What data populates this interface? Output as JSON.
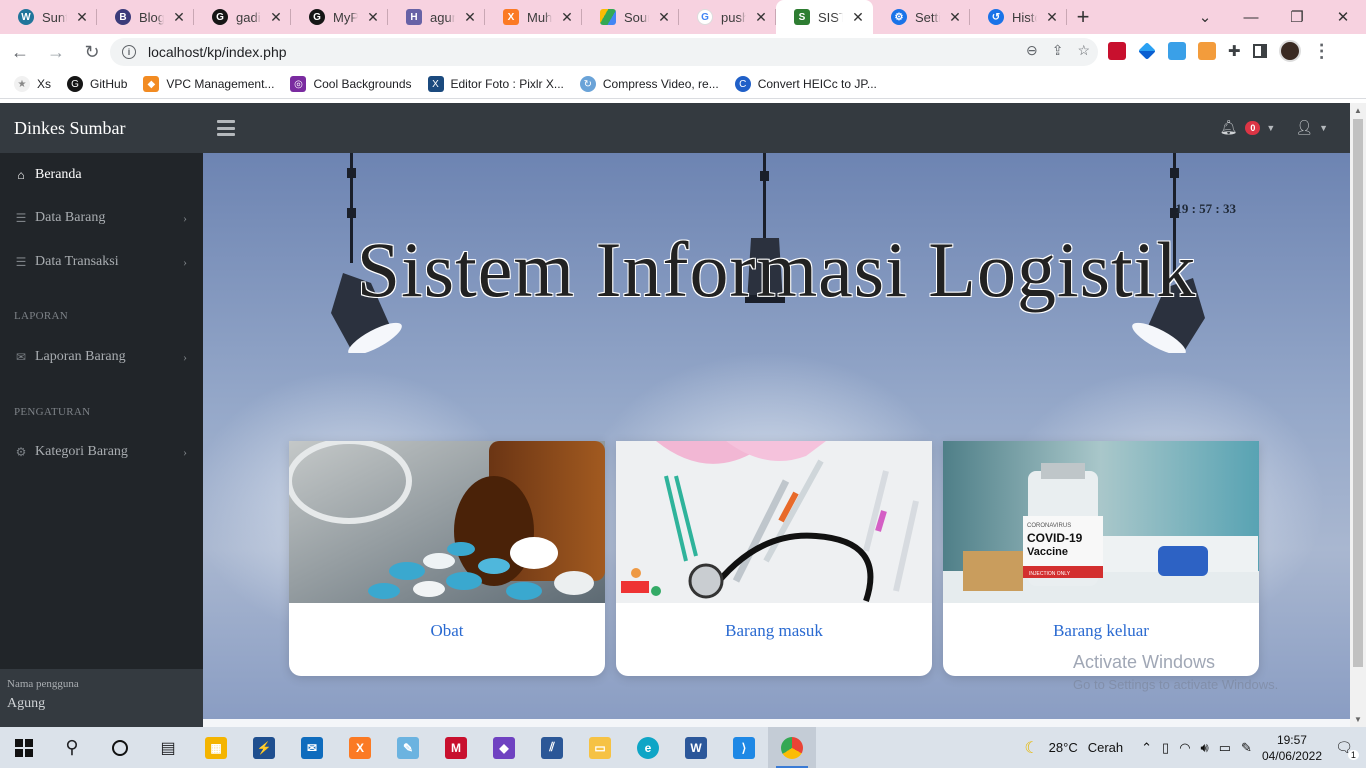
{
  "browser": {
    "tabs": [
      {
        "label": "Suntin",
        "icon": "wordpress-icon",
        "color": "#21759b",
        "glyph": "W"
      },
      {
        "label": "Blog -",
        "icon": "blog-icon",
        "color": "#3b3b7a",
        "glyph": "B"
      },
      {
        "label": "gading",
        "icon": "github-icon",
        "color": "#161616",
        "glyph": "G"
      },
      {
        "label": "MyPor",
        "icon": "github-icon",
        "color": "#161616",
        "glyph": "G"
      },
      {
        "label": "agung",
        "icon": "heroku-icon",
        "color": "#6762a6",
        "glyph": "H"
      },
      {
        "label": "Muhar",
        "icon": "xampp-icon",
        "color": "#fb7a24",
        "glyph": "X"
      },
      {
        "label": "Source",
        "icon": "drive-icon",
        "color": "#34a853",
        "glyph": "▲"
      },
      {
        "label": "push n",
        "icon": "google-icon",
        "color": "#4285f4",
        "glyph": "G"
      },
      {
        "label": "SISTEM",
        "icon": "sumbar-icon",
        "color": "#2e7d32",
        "glyph": "S",
        "active": true
      },
      {
        "label": "Setting",
        "icon": "settings-icon",
        "color": "#1a73e8",
        "glyph": "⚙"
      },
      {
        "label": "History",
        "icon": "history-icon",
        "color": "#1a73e8",
        "glyph": "↺"
      }
    ],
    "url": "localhost/kp/index.php",
    "bookmarks": [
      {
        "label": "Xs",
        "color": "#d8d8d8",
        "glyph": "★"
      },
      {
        "label": "GitHub",
        "color": "#161616",
        "glyph": "G"
      },
      {
        "label": "VPC Management...",
        "color": "#f28b22",
        "glyph": "◆"
      },
      {
        "label": "Cool Backgrounds",
        "color": "#7a2ba0",
        "glyph": "◎"
      },
      {
        "label": "Editor Foto : Pixlr X...",
        "color": "#1b4a7e",
        "glyph": "X"
      },
      {
        "label": "Compress Video, re...",
        "color": "#6aa3d8",
        "glyph": "↻"
      },
      {
        "label": "Convert HEICc to JP...",
        "color": "#2060c8",
        "glyph": "C"
      }
    ]
  },
  "app": {
    "brand": "Dinkes Sumbar",
    "notification_count": "0",
    "sidebar": {
      "items": [
        {
          "label": "Beranda"
        },
        {
          "label": "Data Barang"
        },
        {
          "label": "Data Transaksi"
        },
        {
          "label": "Laporan Barang"
        },
        {
          "label": "Kategori Barang"
        }
      ],
      "headings": [
        "LAPORAN",
        "PENGATURAN"
      ],
      "footer_label": "Nama pengguna",
      "footer_user": "Agung"
    },
    "clock": "19 : 57 : 33",
    "hero_title": "Sistem Informasi Logistik",
    "cards": [
      {
        "title": "Obat"
      },
      {
        "title": "Barang masuk"
      },
      {
        "title": "Barang keluar"
      }
    ],
    "vaccine_label_1": "CORONAVIRUS",
    "vaccine_label_2": "COVID-19",
    "vaccine_label_3": "Vaccine",
    "vaccine_label_4": "INJECTION ONLY"
  },
  "watermark": {
    "line1": "Activate Windows",
    "line2": "Go to Settings to activate Windows."
  },
  "taskbar": {
    "temperature": "28°C",
    "weather": "Cerah",
    "time": "19:57",
    "date": "04/06/2022",
    "notifications": "1"
  }
}
